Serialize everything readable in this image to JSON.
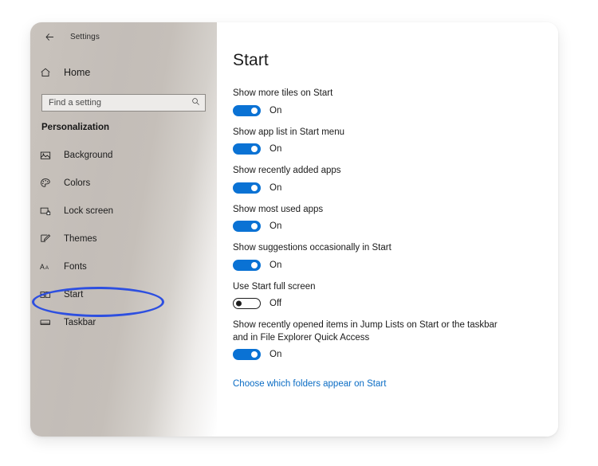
{
  "window": {
    "titlebar": {
      "back_icon": "back-arrow-icon",
      "title": "Settings"
    }
  },
  "sidebar": {
    "home": {
      "icon": "home-icon",
      "label": "Home"
    },
    "search": {
      "placeholder": "Find a setting",
      "value": "",
      "icon": "search-icon"
    },
    "section_heading": "Personalization",
    "items": [
      {
        "icon": "picture-icon",
        "label": "Background",
        "selected": false
      },
      {
        "icon": "palette-icon",
        "label": "Colors",
        "selected": false
      },
      {
        "icon": "lock-screen-icon",
        "label": "Lock screen",
        "selected": false
      },
      {
        "icon": "brush-icon",
        "label": "Themes",
        "selected": false
      },
      {
        "icon": "fonts-aa-icon",
        "label": "Fonts",
        "selected": false
      },
      {
        "icon": "start-tiles-icon",
        "label": "Start",
        "selected": true
      },
      {
        "icon": "taskbar-icon",
        "label": "Taskbar",
        "selected": false
      }
    ],
    "annotation": {
      "shape": "ellipse",
      "target": "Start",
      "color": "#2d4fe0"
    }
  },
  "main": {
    "title": "Start",
    "settings": [
      {
        "label": "Show more tiles on Start",
        "state": "On",
        "on": true
      },
      {
        "label": "Show app list in Start menu",
        "state": "On",
        "on": true
      },
      {
        "label": "Show recently added apps",
        "state": "On",
        "on": true
      },
      {
        "label": "Show most used apps",
        "state": "On",
        "on": true
      },
      {
        "label": "Show suggestions occasionally in Start",
        "state": "On",
        "on": true
      },
      {
        "label": "Use Start full screen",
        "state": "Off",
        "on": false
      },
      {
        "label": "Show recently opened items in Jump Lists on Start or the taskbar and in File Explorer Quick Access",
        "state": "On",
        "on": true
      }
    ],
    "link": "Choose which folders appear on Start"
  },
  "colors": {
    "accent": "#0a72d4",
    "link": "#0a6cc4",
    "annotation": "#2d4fe0"
  }
}
